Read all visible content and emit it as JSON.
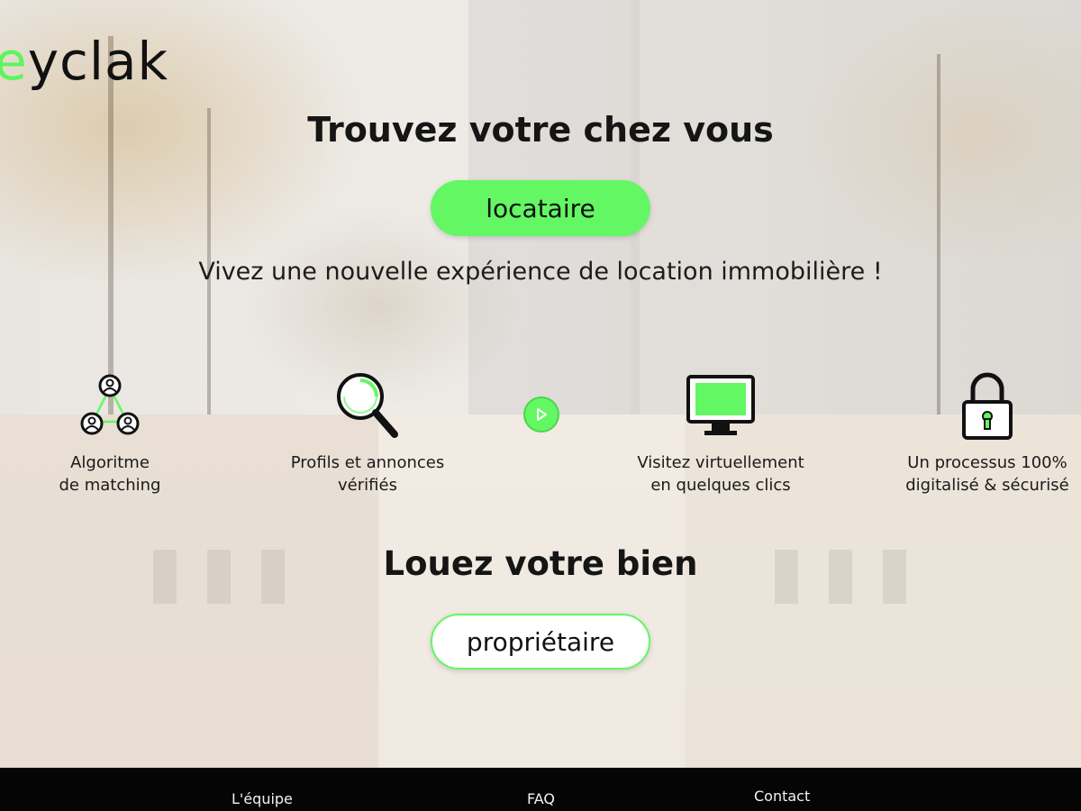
{
  "brand": {
    "logo_accent": "e",
    "logo_rest": "yclak",
    "accent_color": "#63f763"
  },
  "hero": {
    "title_bold": "Trouvez",
    "title_rest": " votre chez vous",
    "cta_label": "locataire",
    "tagline": "Vivez une nouvelle expérience de location immobilière !"
  },
  "features": [
    {
      "icon": "network-icon",
      "line1": "Algoritme",
      "line2": "de matching"
    },
    {
      "icon": "magnifier-icon",
      "line1": "Profils et annonces",
      "line2": "vérifiés"
    },
    {
      "icon": "monitor-icon",
      "line1": "Visitez virtuellement",
      "line2": "en quelques clics"
    },
    {
      "icon": "padlock-icon",
      "line1": "Un processus 100%",
      "line2": "digitalisé & sécurisé"
    }
  ],
  "video": {
    "icon": "play-icon"
  },
  "owner": {
    "title_bold": "Louez",
    "title_rest": " votre bien",
    "cta_label": "propriétaire"
  },
  "footer": {
    "links": [
      "L'équipe",
      "FAQ",
      "Contact"
    ]
  }
}
